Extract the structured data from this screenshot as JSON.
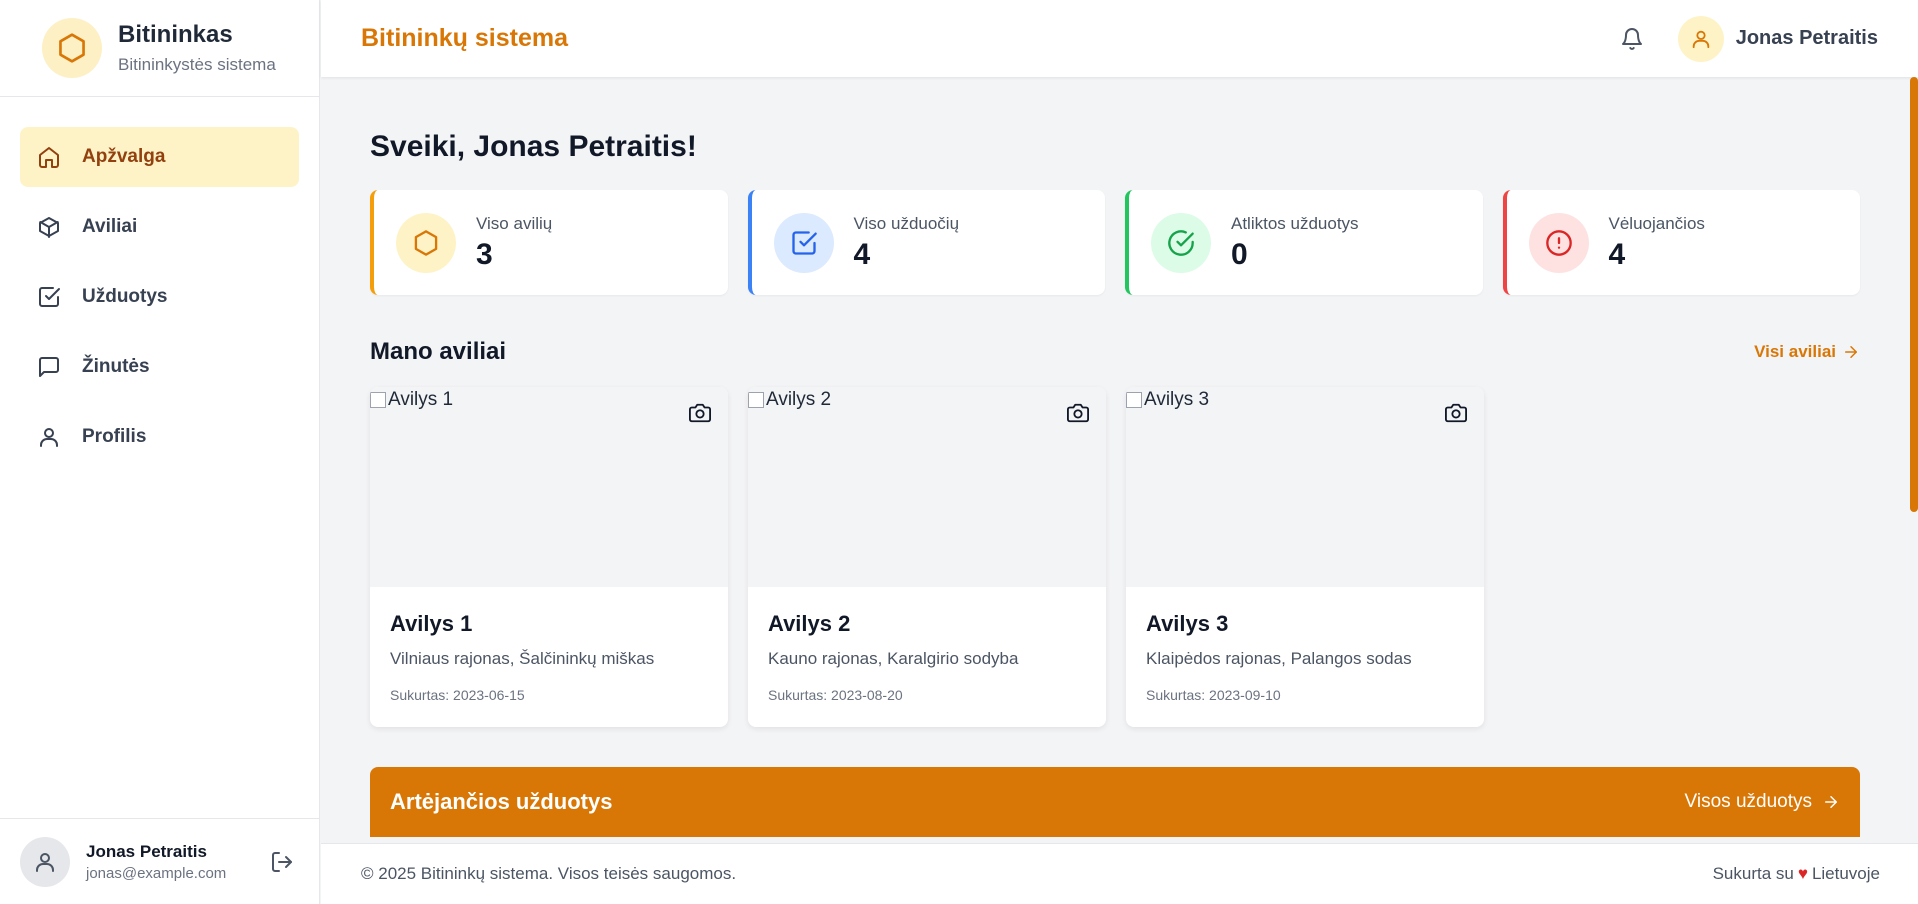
{
  "brand": {
    "title": "Bitininkas",
    "subtitle": "Bitininkystės sistema"
  },
  "nav": [
    {
      "label": "Apžvalga",
      "icon": "home-icon",
      "active": true
    },
    {
      "label": "Aviliai",
      "icon": "cube-icon",
      "active": false
    },
    {
      "label": "Užduotys",
      "icon": "checkbox-icon",
      "active": false
    },
    {
      "label": "Žinutės",
      "icon": "message-icon",
      "active": false
    },
    {
      "label": "Profilis",
      "icon": "user-icon",
      "active": false
    }
  ],
  "sidebar_user": {
    "name": "Jonas Petraitis",
    "email": "jonas@example.com"
  },
  "header": {
    "title": "Bitininkų sistema",
    "user_name": "Jonas Petraitis"
  },
  "greeting": "Sveiki, Jonas Petraitis!",
  "stats": [
    {
      "label": "Viso avilių",
      "value": "3",
      "color": "#f59e0b",
      "bg": "#fef3c7",
      "icon": "hexagon-icon"
    },
    {
      "label": "Viso užduočių",
      "value": "4",
      "color": "#3b82f6",
      "bg": "#dbeafe",
      "icon": "checkbox-icon"
    },
    {
      "label": "Atliktos užduotys",
      "value": "0",
      "color": "#22c55e",
      "bg": "#dcfce7",
      "icon": "check-circle-icon"
    },
    {
      "label": "Vėluojančios",
      "value": "4",
      "color": "#ef4444",
      "bg": "#fee2e2",
      "icon": "alert-circle-icon"
    }
  ],
  "hives_section": {
    "title": "Mano aviliai",
    "link": "Visi aviliai"
  },
  "hives": [
    {
      "alt": "Avilys 1",
      "name": "Avilys 1",
      "location": "Vilniaus rajonas, Šalčininkų miškas",
      "created": "Sukurtas: 2023-06-15"
    },
    {
      "alt": "Avilys 2",
      "name": "Avilys 2",
      "location": "Kauno rajonas, Karalgirio sodyba",
      "created": "Sukurtas: 2023-08-20"
    },
    {
      "alt": "Avilys 3",
      "name": "Avilys 3",
      "location": "Klaipėdos rajonas, Palangos sodas",
      "created": "Sukurtas: 2023-09-10"
    }
  ],
  "tasks_section": {
    "title": "Artėjančios užduotys",
    "link": "Visos užduotys"
  },
  "footer": {
    "copyright": "© 2025 Bitininkų sistema. Visos teisės saugomos.",
    "made_prefix": "Sukurta su",
    "heart": "♥",
    "made_suffix": "Lietuvoje"
  },
  "colors": {
    "accent": "#d97706",
    "active_bg": "#fef3c7",
    "active_text": "#92400e"
  }
}
